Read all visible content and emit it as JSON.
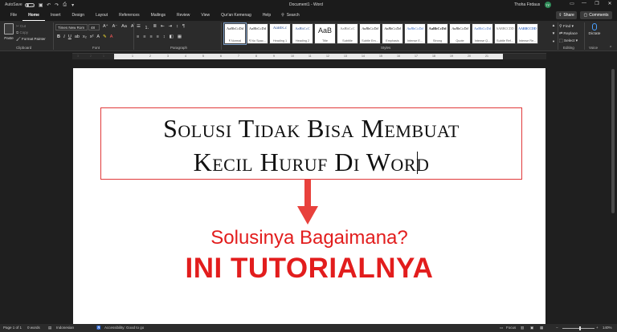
{
  "title_bar": {
    "autosave_label": "AutoSave",
    "autosave_state": "Off",
    "document_title": "Document1 - Word",
    "user_name": "Thoha Firdaus",
    "user_initials": "TF",
    "minimize": "—",
    "restore": "❐",
    "close": "✕"
  },
  "menu": {
    "tabs": [
      "File",
      "Home",
      "Insert",
      "Design",
      "Layout",
      "References",
      "Mailings",
      "Review",
      "View",
      "Qur'an Kemenag",
      "Help"
    ],
    "active_tab": "Home",
    "search_label": "Search",
    "share_label": "Share",
    "comments_label": "Comments"
  },
  "ribbon": {
    "clipboard": {
      "paste_label": "Paste",
      "cut": "Cut",
      "copy": "Copy",
      "format_painter": "Format Painter",
      "group_label": "Clipboard"
    },
    "font": {
      "font_name": "Times New Rom",
      "font_size": "48",
      "group_label": "Font"
    },
    "paragraph": {
      "group_label": "Paragraph"
    },
    "styles": {
      "group_label": "Styles",
      "items": [
        {
          "sample": "AaBbCcDd",
          "name": "¶ Normal"
        },
        {
          "sample": "AaBbCcDd",
          "name": "¶ No Spac..."
        },
        {
          "sample": "AaBbCc",
          "name": "Heading 1"
        },
        {
          "sample": "AaBbCcC",
          "name": "Heading 2"
        },
        {
          "sample": "AaB",
          "name": "Title"
        },
        {
          "sample": "AaBbCcC",
          "name": "Subtitle"
        },
        {
          "sample": "AaBbCcDd",
          "name": "Subtle Em..."
        },
        {
          "sample": "AaBbCcDd",
          "name": "Emphasis"
        },
        {
          "sample": "AaBbCcDd",
          "name": "Intense E..."
        },
        {
          "sample": "AaBbCcDd",
          "name": "Strong"
        },
        {
          "sample": "AaBbCcDd",
          "name": "Quote"
        },
        {
          "sample": "AaBbCcDd",
          "name": "Intense Q..."
        },
        {
          "sample": "AaBbCcDd",
          "name": "Subtle Ref..."
        },
        {
          "sample": "AaBbCcDd",
          "name": "Intense Re..."
        }
      ]
    },
    "editing": {
      "find": "Find",
      "replace": "Replace",
      "select": "Select",
      "group_label": "Editing"
    },
    "voice": {
      "dictate": "Dictate",
      "group_label": "Voice"
    }
  },
  "ruler": {
    "labels": [
      "3",
      "2",
      "1",
      "1",
      "2",
      "3",
      "4",
      "5",
      "6",
      "7",
      "8",
      "9",
      "10",
      "11",
      "12",
      "13",
      "14",
      "15",
      "16",
      "17",
      "18",
      "19",
      "20",
      "21"
    ]
  },
  "document": {
    "heading_line1": "Solusi Tidak Bisa Membuat",
    "heading_line2": "Kecil Huruf Di Word",
    "subtitle": "Solusinya Bagaimana?",
    "banner": "INI TUTORIALNYA",
    "accent_color": "#e21d1d"
  },
  "status_bar": {
    "page": "Page 1 of 1",
    "words": "0 words",
    "language": "Indonesian",
    "accessibility": "Accessibility: Good to go",
    "focus": "Focus",
    "zoom": "140%"
  }
}
